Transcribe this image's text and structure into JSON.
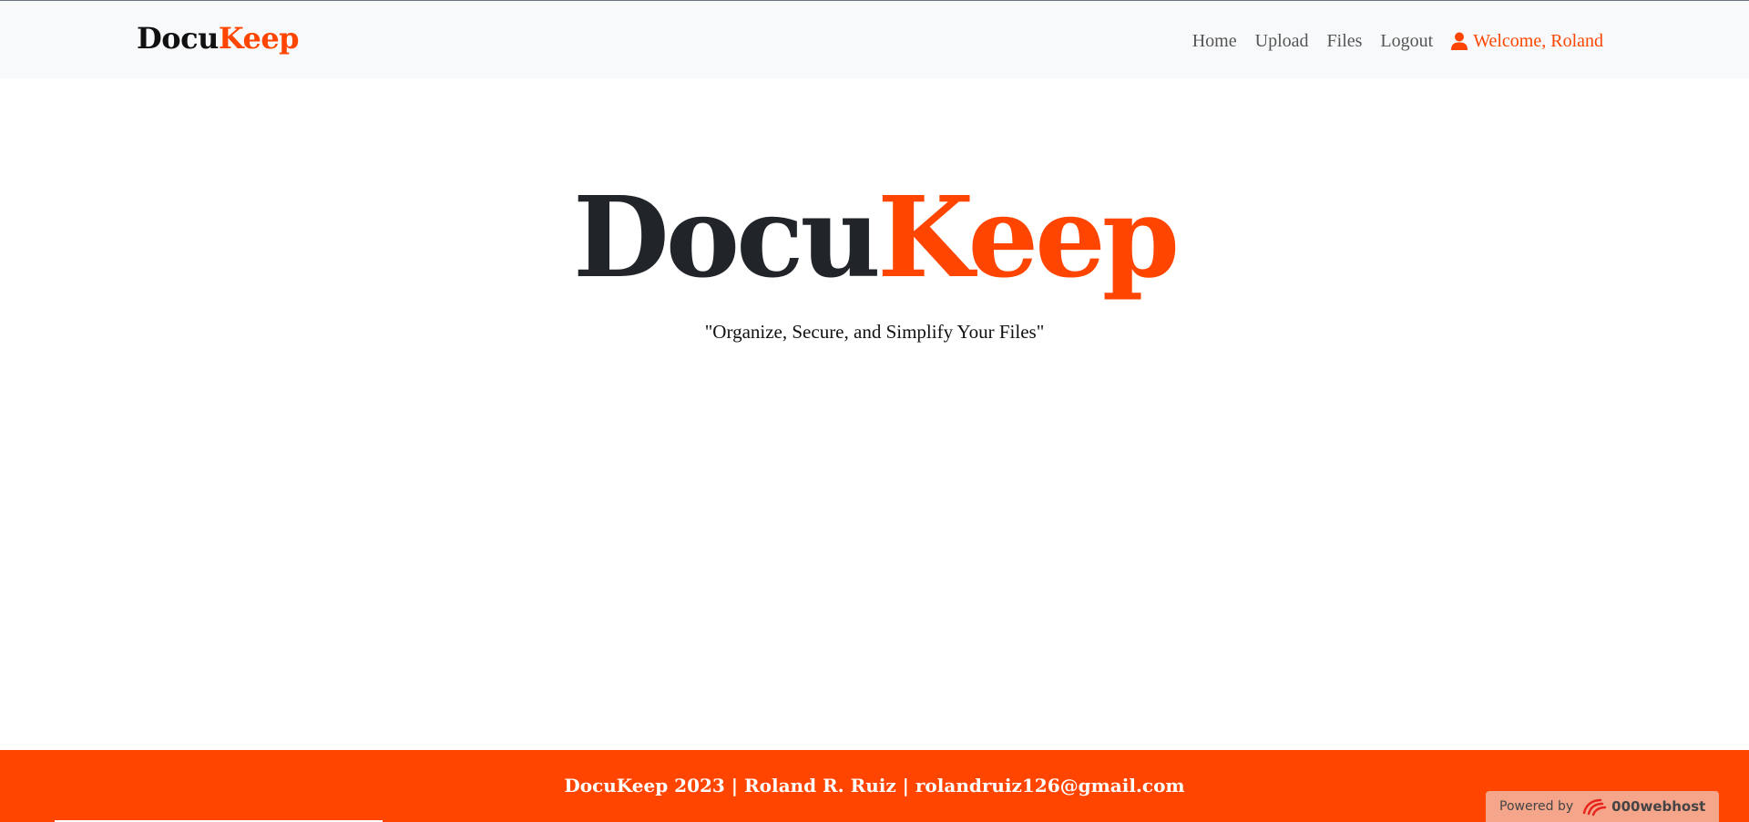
{
  "navbar": {
    "brand_docu": "Docu",
    "brand_keep": "Keep",
    "links": [
      "Home",
      "Upload",
      "Files",
      "Logout"
    ],
    "user_label": "Welcome, Roland",
    "user_icon": "user-icon"
  },
  "hero": {
    "title_docu": "Docu",
    "title_keep": "Keep",
    "tagline": "\"Organize, Secure, and Simplify Your Files\""
  },
  "footer": {
    "text": "DocuKeep 2023 | Roland R. Ruiz | rolandruiz126@gmail.com"
  },
  "badge": {
    "prefix": "Powered by",
    "name": "000webhost",
    "icon": "000webhost-logo-icon"
  },
  "colors": {
    "accent": "#ff4500",
    "navbar_bg": "#f8f9fa",
    "footer_bg": "#ff4500"
  }
}
